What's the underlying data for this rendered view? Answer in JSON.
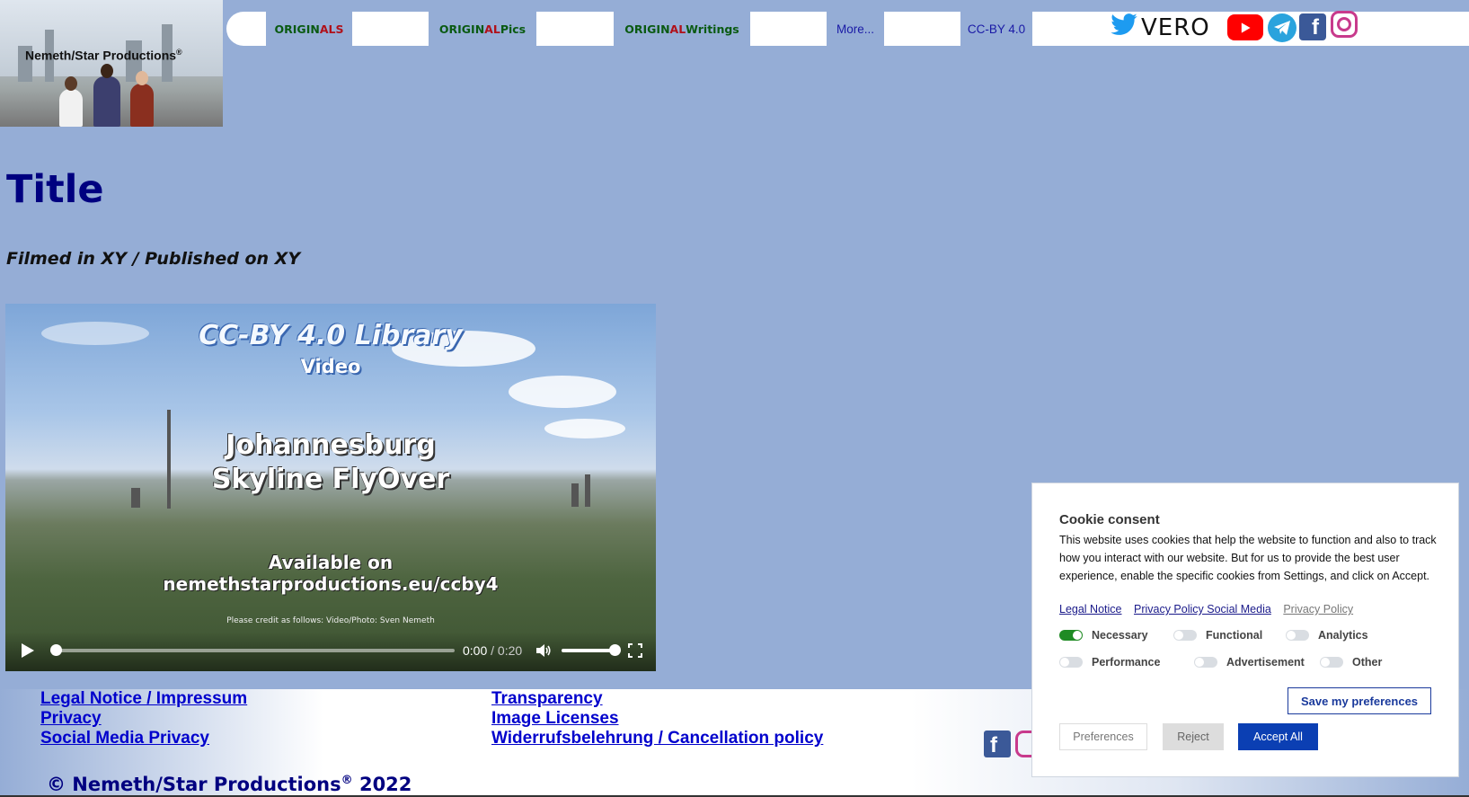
{
  "brand": {
    "name": "Nemeth/Star Productions",
    "mark": "®"
  },
  "nav": {
    "originals": {
      "a": "ORIGIN",
      "b": "ALS"
    },
    "original_pics": {
      "a": "ORIGIN",
      "b": "AL",
      "c": " Pics"
    },
    "original_writings": {
      "a": "ORIGIN",
      "b": "AL",
      "c": " Writings"
    },
    "more": "More...",
    "ccby": "CC-BY 4.0"
  },
  "social": {
    "vero": "VERO",
    "facebook": "f"
  },
  "content": {
    "title": "Title",
    "subtitle": "Filmed in XY / Published on XY"
  },
  "video": {
    "library": "CC-BY 4.0 Library",
    "label": "Video",
    "place_line1": "Johannesburg",
    "place_line2": "Skyline FlyOver",
    "available": "Available on",
    "url": "nemethstarproductions.eu/ccby4",
    "credit": "Please credit as follows: Video/Photo: Sven Nemeth",
    "time_current": "0:00",
    "time_sep": " / ",
    "time_total": "0:20"
  },
  "footer": {
    "legal": "Legal Notice / Impressum",
    "privacy": "Privacy",
    "social_privacy": "Social Media Privacy",
    "transparency": "Transparency",
    "image_licenses": "Image Licenses",
    "cancellation": "Widerrufsbelehrung / Cancellation policy",
    "copyright": "© Nemeth/Star Productions",
    "copyright_mark": "®",
    "year": " 2022",
    "facebook": "f"
  },
  "cookie": {
    "title": "Cookie consent",
    "text": "This website uses cookies that help the website to function and also to track how you interact with our website. But for us to provide the best user experience, enable the specific cookies from Settings, and click on Accept.",
    "link_legal": "Legal Notice",
    "link_social": "Privacy Policy Social Media",
    "link_privacy": "Privacy Policy",
    "toggles": {
      "necessary": "Necessary",
      "functional": "Functional",
      "analytics": "Analytics",
      "performance": "Performance",
      "advertisement": "Advertisement",
      "other": "Other"
    },
    "save": "Save my preferences",
    "preferences": "Preferences",
    "reject": "Reject",
    "accept": "Accept All"
  },
  "colors": {
    "background": "#95add6",
    "navy": "#000080",
    "accept": "#0b3fb3",
    "toggle_on": "#1f8b24"
  }
}
